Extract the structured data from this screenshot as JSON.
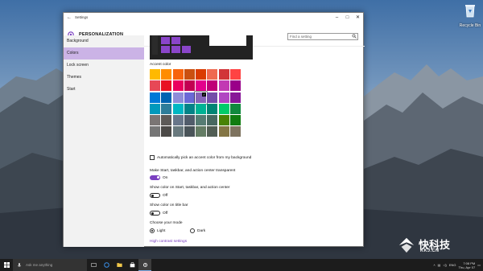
{
  "desktop": {
    "recycle_bin_label": "Recycle Bin"
  },
  "window": {
    "title": "Settings",
    "controls": [
      "minimize",
      "maximize",
      "close"
    ]
  },
  "header": {
    "heading": "PERSONALIZATION",
    "search_placeholder": "Find a setting"
  },
  "sidebar": {
    "items": [
      {
        "label": "Background",
        "active": false
      },
      {
        "label": "Colors",
        "active": true
      },
      {
        "label": "Lock screen",
        "active": false
      },
      {
        "label": "Themes",
        "active": false
      },
      {
        "label": "Start",
        "active": false
      }
    ]
  },
  "colors": {
    "accent_label": "Accent color",
    "swatches": [
      "#ffb900",
      "#ff8c00",
      "#f7630c",
      "#ca5010",
      "#da3b01",
      "#ef6950",
      "#d13438",
      "#ff4343",
      "#e74856",
      "#e81123",
      "#ea005e",
      "#c30052",
      "#e3008c",
      "#bf0077",
      "#c239b3",
      "#9a0089",
      "#0078d7",
      "#0063b1",
      "#8e8cd8",
      "#6b69d6",
      "#8764b8",
      "#744da9",
      "#b146c2",
      "#881798",
      "#0099bc",
      "#2d7d9a",
      "#00b7c3",
      "#038387",
      "#00b294",
      "#018574",
      "#00cc6a",
      "#10893e",
      "#7a7574",
      "#5d5a58",
      "#68768a",
      "#515c6b",
      "#567c73",
      "#486860",
      "#498205",
      "#107c10",
      "#767676",
      "#4c4a48",
      "#69797e",
      "#4a5459",
      "#647c64",
      "#525e54",
      "#847545",
      "#7e735f"
    ],
    "selected_index": 20,
    "auto_pick_label": "Automatically pick an accent color from my background",
    "transparent_label": "Make Start, taskbar, and action center transparent",
    "transparent_state": "On",
    "show_color_start_label": "Show color on Start, taskbar, and action center",
    "show_color_start_state": "Off",
    "show_color_title_label": "Show color on title bar",
    "show_color_title_state": "Off",
    "mode_label": "Choose your mode",
    "mode_light": "Light",
    "mode_dark": "Dark",
    "high_contrast_link": "High contrast settings",
    "accent_color": "#7a3fc0"
  },
  "taskbar": {
    "search_placeholder": "Ask me anything",
    "language": "ENG",
    "time": "7:08 PM",
    "date": "Thu, Apr 07"
  },
  "watermark": {
    "chinese": "快科技",
    "english": "KKJ.CN"
  }
}
